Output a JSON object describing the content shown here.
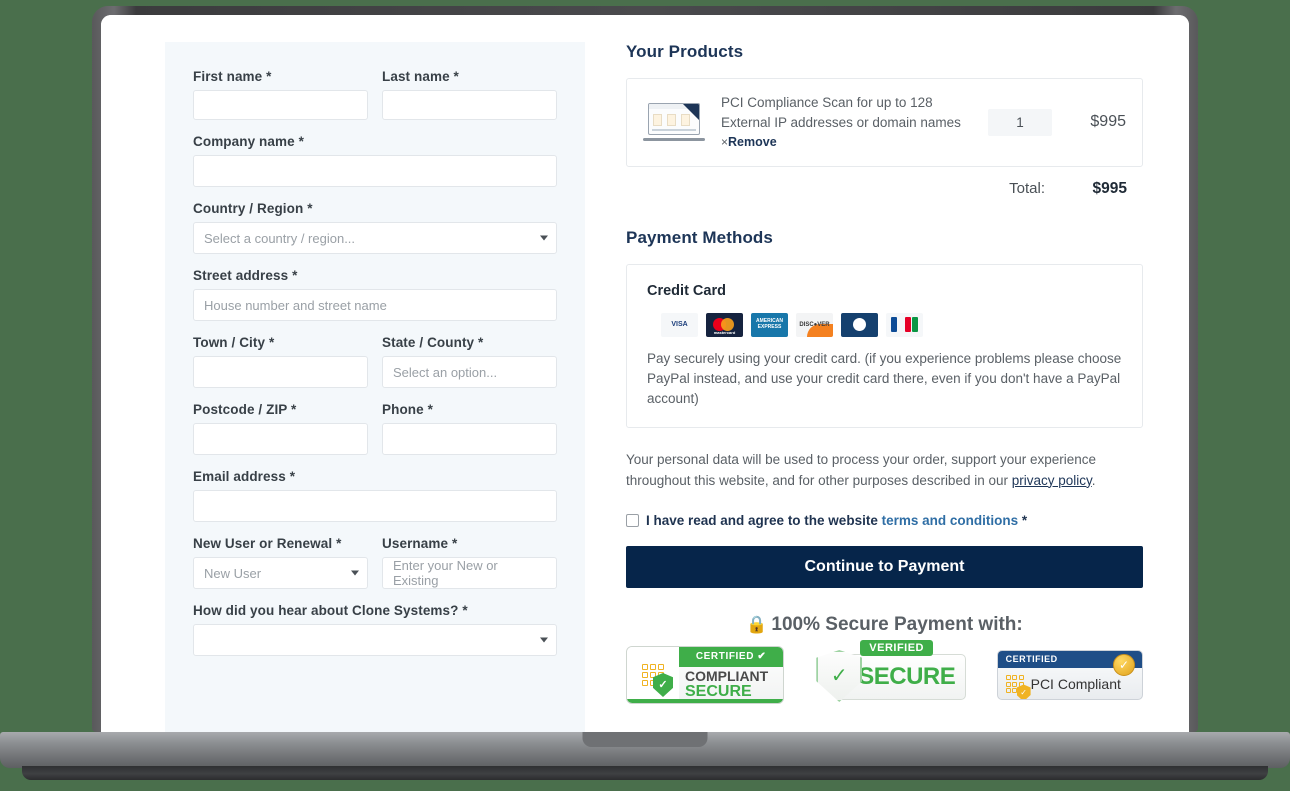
{
  "form": {
    "fields": [
      {
        "label": "First name",
        "required": "*",
        "value": "",
        "placeholder": "",
        "type": "input"
      },
      {
        "label": "Last name",
        "required": "*",
        "value": "",
        "placeholder": "",
        "type": "input"
      },
      {
        "label": "Company name",
        "required": "*",
        "value": "",
        "placeholder": "",
        "type": "input"
      },
      {
        "label": "Country / Region",
        "required": "*",
        "value": "Select a country / region...",
        "type": "select"
      },
      {
        "label": "Street address",
        "required": "*",
        "value": "",
        "placeholder": "House number and street name",
        "type": "input"
      },
      {
        "label": "Town / City",
        "required": "*",
        "value": "",
        "placeholder": "",
        "type": "input"
      },
      {
        "label": "State / County",
        "required": "*",
        "value": "Select an option...",
        "type": "select"
      },
      {
        "label": "Postcode / ZIP",
        "required": "*",
        "value": "",
        "placeholder": "",
        "type": "input"
      },
      {
        "label": "Phone",
        "required": "*",
        "value": "",
        "placeholder": "",
        "type": "input"
      },
      {
        "label": "Email address",
        "required": "*",
        "value": "",
        "placeholder": "",
        "type": "input"
      },
      {
        "label": "New User or Renewal",
        "required": "*",
        "value": "New User",
        "type": "select"
      },
      {
        "label": "Username",
        "required": "*",
        "value": "",
        "placeholder": "Enter your New or Existing",
        "type": "input"
      },
      {
        "label": "How did you hear about Clone Systems?",
        "required": "*",
        "value": "",
        "type": "select"
      }
    ]
  },
  "products": {
    "heading": "Your Products",
    "item": {
      "name": "PCI Compliance Scan for up to 128 External IP addresses or domain names",
      "remove_x": "×",
      "remove_label": "Remove",
      "quantity": "1",
      "price": "$995",
      "thumb_icon": "laptop-dashboard-icon"
    },
    "total_label": "Total:",
    "total_value": "$995"
  },
  "payment": {
    "heading": "Payment Methods",
    "method_title": "Credit Card",
    "cards": [
      {
        "name": "visa-card-icon",
        "label": "VISA"
      },
      {
        "name": "mastercard-card-icon",
        "label": "mastercard"
      },
      {
        "name": "amex-card-icon",
        "label": "AMERICAN EXPRESS"
      },
      {
        "name": "discover-card-icon",
        "label": "DISCVER"
      },
      {
        "name": "diners-club-card-icon",
        "label": "Diners Club"
      },
      {
        "name": "jcb-card-icon",
        "label": "JCB"
      }
    ],
    "description": "Pay securely using your credit card. (if you experience problems please choose PayPal instead, and use your credit card there, even if you don't have a PayPal account)"
  },
  "legal": {
    "privacy_text_before": "Your personal data will be used to process your order, support your experience throughout this website, and for other purposes described in our ",
    "privacy_link": "privacy policy",
    "privacy_text_after": ".",
    "terms_before": "I have read and agree to the website ",
    "terms_link": "terms and conditions",
    "terms_after": " *"
  },
  "cta": {
    "label": "Continue to Payment"
  },
  "secure": {
    "lock_icon": "🔒",
    "heading": "100% Secure Payment with:",
    "badges": [
      {
        "name": "compliant-secure-badge",
        "top": "CERTIFIED",
        "check": "✔",
        "line1": "COMPLIANT",
        "line2": "SECURE"
      },
      {
        "name": "verified-secure-badge",
        "tag": "VERIFIED",
        "text": "SECURE",
        "check": "✓"
      },
      {
        "name": "pci-compliant-badge",
        "top": "CERTIFIED",
        "text": "PCI Compliant",
        "seal": "✓"
      }
    ]
  },
  "colors": {
    "page_bg": "#4a6f4c",
    "panel_bg": "#f4f8fb",
    "accent_navy": "#1d3557",
    "cta_bg": "#06254a",
    "green": "#3fae49"
  }
}
